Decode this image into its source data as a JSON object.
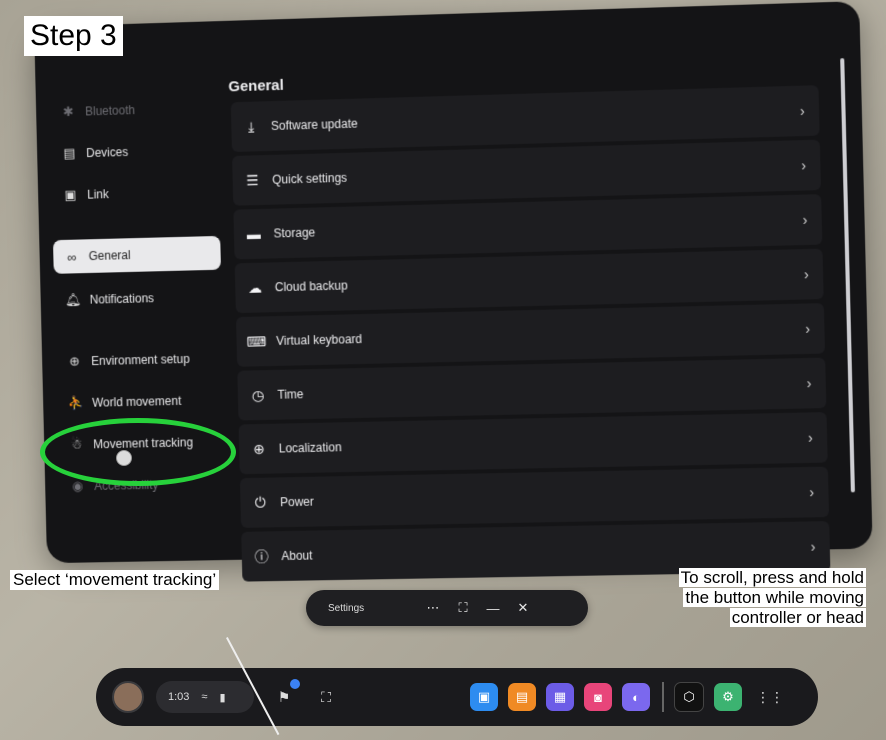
{
  "step_label": "Step 3",
  "panel": {
    "title": "General",
    "sidebar": [
      {
        "label": "Bluetooth",
        "icon": "bluetooth-icon",
        "state": "dim"
      },
      {
        "label": "Devices",
        "icon": "devices-icon",
        "state": "normal"
      },
      {
        "label": "Link",
        "icon": "link-icon",
        "state": "normal"
      },
      {
        "label": "General",
        "icon": "general-icon",
        "state": "active"
      },
      {
        "label": "Notifications",
        "icon": "bell-icon",
        "state": "normal"
      },
      {
        "label": "Environment setup",
        "icon": "environment-icon",
        "state": "normal"
      },
      {
        "label": "World movement",
        "icon": "world-movement-icon",
        "state": "normal"
      },
      {
        "label": "Movement tracking",
        "icon": "movement-tracking-icon",
        "state": "normal"
      },
      {
        "label": "Accessibility",
        "icon": "accessibility-icon",
        "state": "dim"
      }
    ],
    "rows": [
      {
        "label": "Software update",
        "icon": "download-icon"
      },
      {
        "label": "Quick settings",
        "icon": "sliders-icon"
      },
      {
        "label": "Storage",
        "icon": "storage-icon"
      },
      {
        "label": "Cloud backup",
        "icon": "cloud-icon"
      },
      {
        "label": "Virtual keyboard",
        "icon": "keyboard-icon"
      },
      {
        "label": "Time",
        "icon": "clock-icon"
      },
      {
        "label": "Localization",
        "icon": "globe-icon"
      },
      {
        "label": "Power",
        "icon": "power-icon"
      },
      {
        "label": "About",
        "icon": "info-icon"
      }
    ],
    "chevron": "›"
  },
  "captions": {
    "select": "Select ‘movement tracking’",
    "scroll_1": "To scroll, press and hold",
    "scroll_2": "the button while moving",
    "scroll_3": "controller or head"
  },
  "window_bar": {
    "title": "Settings",
    "b1": "⋯",
    "b2": "⛶",
    "b3": "—",
    "b4": "✕"
  },
  "dock": {
    "time": "1:03",
    "wifi": "≈",
    "apps": [
      {
        "icon": "app-blue-icon",
        "color": "#2d8cf0"
      },
      {
        "icon": "store-icon",
        "color": "#f08a24"
      },
      {
        "icon": "chat-icon",
        "color": "#6c5ce7"
      },
      {
        "icon": "camera-icon",
        "color": "#e8457a"
      },
      {
        "icon": "app-purple-icon",
        "color": "#7b68ee"
      },
      {
        "icon": "meta-icon",
        "color": "#111111"
      },
      {
        "icon": "settings-app-icon",
        "color": "#3cb371"
      }
    ],
    "grid": "⋮⋮⋮"
  }
}
